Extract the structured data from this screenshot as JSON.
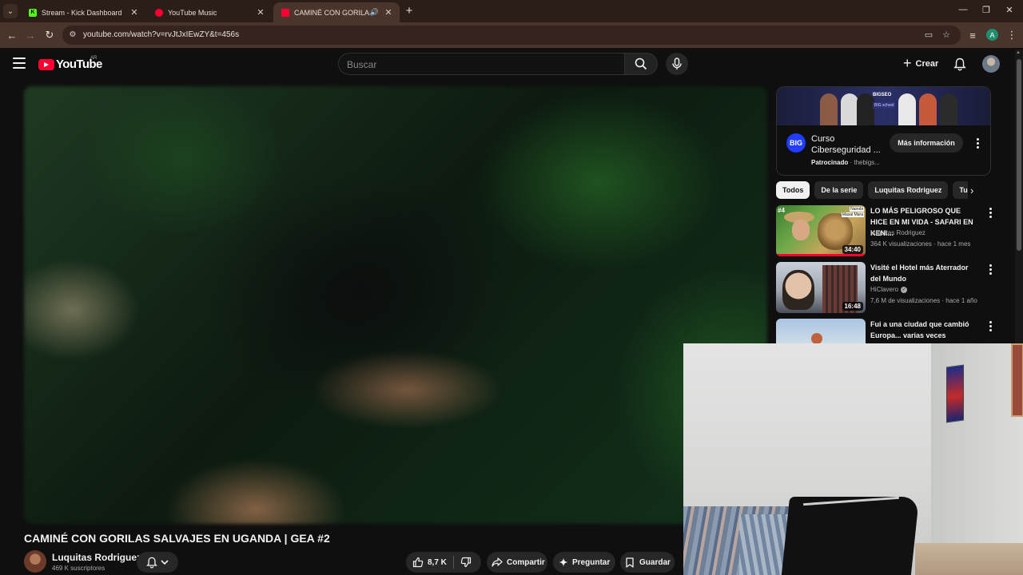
{
  "browser": {
    "tabs": [
      {
        "title": "Stream - Kick Dashboard",
        "favicon_color": "#53fc18",
        "favicon_letter": "K"
      },
      {
        "title": "YouTube Music",
        "favicon_color": "#ff0033",
        "favicon_letter": ""
      },
      {
        "title": "CAMINÉ CON GORILAS SALVAJ",
        "favicon_color": "#ff0033",
        "favicon_letter": "",
        "active": true,
        "audio": true
      }
    ],
    "url": "youtube.com/watch?v=rvJtJxIEwZY&t=456s",
    "profile_letter": "A"
  },
  "header": {
    "logo_text": "YouTube",
    "country_code": "AR",
    "search_placeholder": "Buscar",
    "create_label": "Crear"
  },
  "video": {
    "title": "CAMINÉ CON GORILAS SALVAJES EN UGANDA | GEA #2",
    "channel": "Luquitas Rodriguez",
    "subscribers": "469 K suscriptores",
    "likes": "8,7 K",
    "share_label": "Compartir",
    "ask_label": "Preguntar",
    "save_label": "Guardar"
  },
  "ad": {
    "logo_text": "BIG",
    "banner_tag": "BIGSEO",
    "banner_tag2": "BIG school",
    "title": "Curso Ciberseguridad ...",
    "sponsored": "Patrocinado",
    "domain": "· thebigs...",
    "more_info": "Más información"
  },
  "chips": [
    "Todos",
    "De la serie",
    "Luquitas Rodriguez",
    "Tu"
  ],
  "recommendations": [
    {
      "title": "LO MÁS PELIGROSO QUE HICE EN MI VIDA - SAFARI EN KENI...",
      "channel": "Luquitas Rodriguez",
      "verified": false,
      "meta": "364 K visualizaciones · hace 1 mes",
      "duration": "34:40",
      "badge": "#4",
      "tag1": "Nairobi",
      "tag2": "Masai Mara",
      "progress": 1.0
    },
    {
      "title": "Visité el Hotel más Aterrador del Mundo",
      "channel": "HiClavero",
      "verified": true,
      "meta": "7,6 M de visualizaciones · hace 1 año",
      "duration": "16:48"
    },
    {
      "title": "Fui a una ciudad que cambió Europa... varias veces",
      "channel": "",
      "verified": false,
      "meta": "",
      "duration": ""
    }
  ]
}
